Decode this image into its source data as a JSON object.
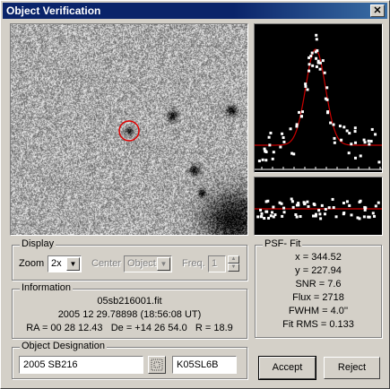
{
  "window": {
    "title": "Object Verification",
    "close_label": "✕"
  },
  "display": {
    "group_label": "Display",
    "zoom_label": "Zoom",
    "zoom_value": "2x",
    "center_label": "Center",
    "center_value": "Object",
    "freq_label": "Freq.",
    "freq_value": "1"
  },
  "information": {
    "group_label": "Information",
    "filename": "05sb216001.fit",
    "datetime": "2005 12 29.78898 (18:56:08 UT)",
    "coords": "RA = 00 28 12.43   De = +14 26 54.0   R = 18.9"
  },
  "designation": {
    "group_label": "Object Designation",
    "name": "2005 SB216",
    "code": "K05SL6B"
  },
  "psf_fit": {
    "group_label": "PSF- Fit",
    "lines": [
      "x = 344.52",
      "y = 227.94",
      "SNR = 7.6",
      "Flux = 2718",
      "FWHM = 4.0''",
      "Fit RMS = 0.133"
    ]
  },
  "buttons": {
    "accept": "Accept",
    "reject": "Reject"
  },
  "colors": {
    "title_bar": "#0a246a",
    "fit_curve": "#cc0000",
    "marker_circle": "#e00000"
  }
}
